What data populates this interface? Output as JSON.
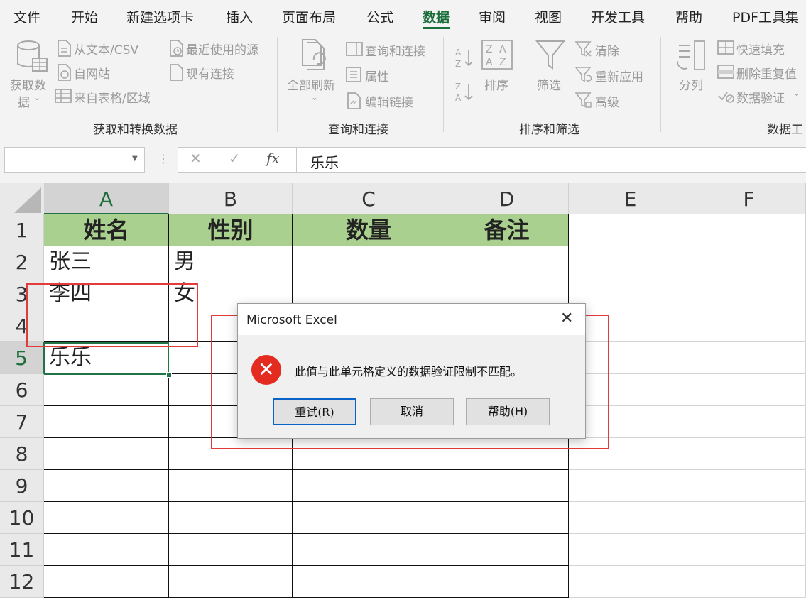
{
  "menu": {
    "tabs": [
      "文件",
      "开始",
      "新建选项卡",
      "插入",
      "页面布局",
      "公式",
      "数据",
      "审阅",
      "视图",
      "开发工具",
      "帮助",
      "PDF工具集"
    ],
    "active_tab": "数据"
  },
  "ribbon": {
    "get_transform": {
      "get_data_line1": "获取数",
      "get_data_line2": "据",
      "from_text_csv": "从文本/CSV",
      "from_web": "自网站",
      "from_table_range": "来自表格/区域",
      "recent_sources": "最近使用的源",
      "existing_connections": "现有连接",
      "title": "获取和转换数据"
    },
    "queries_connections": {
      "refresh_all": "全部刷新",
      "queries_and_connections": "查询和连接",
      "properties": "属性",
      "edit_links": "编辑链接",
      "title": "查询和连接"
    },
    "sort_filter": {
      "sort": "排序",
      "filter": "筛选",
      "clear": "清除",
      "reapply": "重新应用",
      "advanced": "高级",
      "title": "排序和筛选"
    },
    "data_tools": {
      "text_to_columns": "分列",
      "flash_fill": "快速填充",
      "remove_duplicates": "删除重复值",
      "data_validation": "数据验证",
      "title": "数据工"
    }
  },
  "formula_bar": {
    "name_box": "",
    "cancel_icon": "✕",
    "enter_icon": "✓",
    "fx_label": "fx",
    "value": "乐乐"
  },
  "sheet": {
    "columns": [
      "A",
      "B",
      "C",
      "D",
      "E",
      "F"
    ],
    "rows": [
      "1",
      "2",
      "3",
      "4",
      "5",
      "6",
      "7",
      "8",
      "9",
      "10",
      "11",
      "12"
    ],
    "header": [
      "姓名",
      "性别",
      "数量",
      "备注"
    ],
    "data": [
      [
        "张三",
        "男",
        "",
        ""
      ],
      [
        "李四",
        "女",
        "",
        ""
      ],
      [
        "",
        "",
        "",
        ""
      ],
      [
        "乐乐",
        "",
        "",
        ""
      ]
    ],
    "active_cell": "A5"
  },
  "dialog": {
    "title": "Microsoft Excel",
    "message": "此值与此单元格定义的数据验证限制不匹配。",
    "buttons": {
      "retry": "重试(R)",
      "cancel": "取消",
      "help": "帮助(H)"
    },
    "icon": "error-icon",
    "error_color": "#e42b1f"
  },
  "colors": {
    "accent": "#217346",
    "header_fill": "#a9d08e",
    "annotation": "#e23b3b"
  }
}
